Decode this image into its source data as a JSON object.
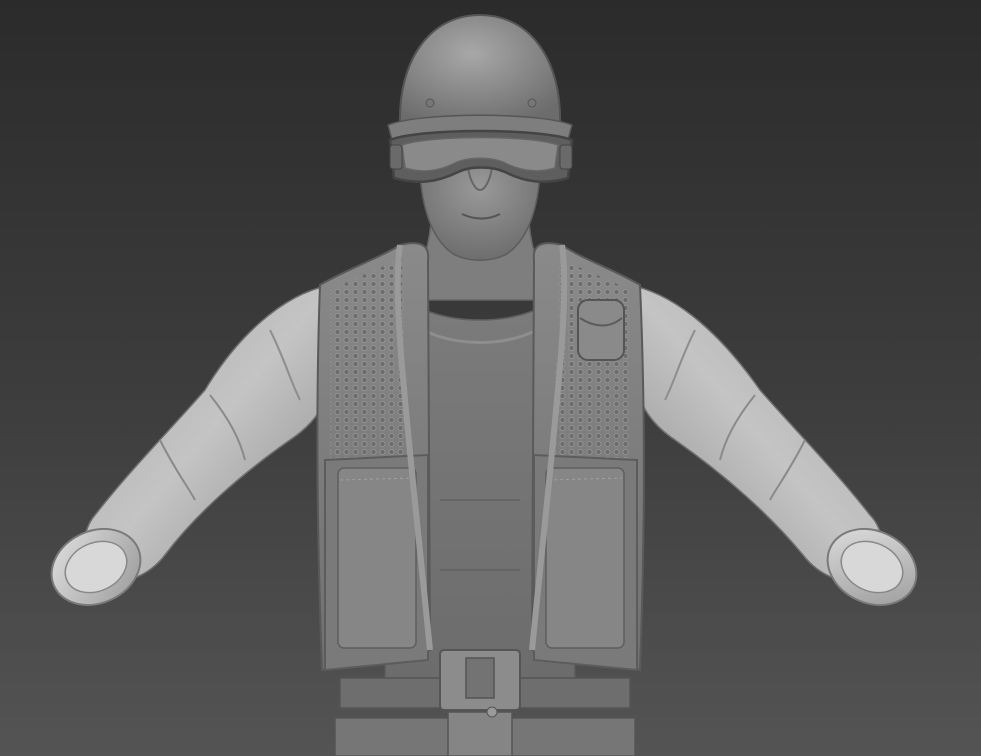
{
  "viewport": {
    "background_top": "#2b2b2b",
    "background_bottom": "#545454"
  },
  "model": {
    "subject": "soldier-bust-sculpt",
    "material_color": "#8c8c8c",
    "parts": [
      "helmet",
      "goggles",
      "face",
      "neck",
      "t-shirt",
      "tactical-vest",
      "chest-pouch",
      "sleeves",
      "cuffs",
      "belt",
      "buckle"
    ]
  }
}
